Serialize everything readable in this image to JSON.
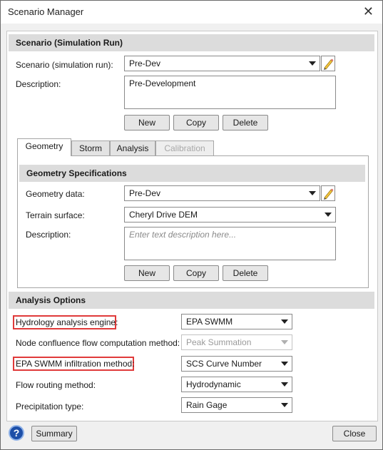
{
  "window": {
    "title": "Scenario Manager"
  },
  "scenario_section": {
    "header": "Scenario (Simulation Run)",
    "scenario_label": "Scenario (simulation run):",
    "scenario_value": "Pre-Dev",
    "description_label": "Description:",
    "description_value": "Pre-Development",
    "new_label": "New",
    "copy_label": "Copy",
    "delete_label": "Delete"
  },
  "tabs": [
    {
      "label": "Geometry",
      "active": true
    },
    {
      "label": "Storm"
    },
    {
      "label": "Analysis"
    },
    {
      "label": "Calibration",
      "disabled": true
    }
  ],
  "geometry": {
    "header": "Geometry Specifications",
    "geometry_label": "Geometry data:",
    "geometry_value": "Pre-Dev",
    "terrain_label": "Terrain surface:",
    "terrain_value": "Cheryl Drive DEM",
    "description_label": "Description:",
    "description_placeholder": "Enter text description here...",
    "new_label": "New",
    "copy_label": "Copy",
    "delete_label": "Delete"
  },
  "analysis_options": {
    "header": "Analysis Options",
    "engine_label": "Hydrology analysis engine:",
    "engine_value": "EPA SWMM",
    "confluence_label": "Node confluence flow computation method:",
    "confluence_value": "Peak Summation",
    "infiltration_label": "EPA SWMM infiltration method:",
    "infiltration_value": "SCS Curve Number",
    "routing_label": "Flow routing method:",
    "routing_value": "Hydrodynamic",
    "precip_label": "Precipitation type:",
    "precip_value": "Rain Gage"
  },
  "footer": {
    "help_symbol": "?",
    "summary_label": "Summary",
    "close_label": "Close"
  },
  "colors": {
    "highlight": "#e03a3a",
    "section_header": "#dcdcdc",
    "help_icon": "#1d4fa8"
  }
}
